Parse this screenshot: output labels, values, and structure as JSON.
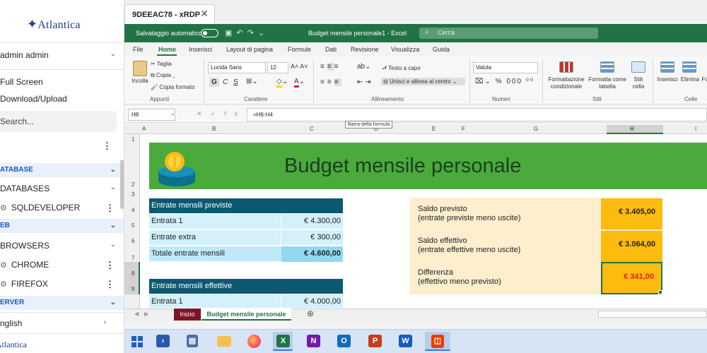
{
  "sidebar": {
    "logo": "Atlantica",
    "user": "admin admin",
    "full_screen": "Full Screen",
    "download_upload": "Download/Upload",
    "search_placeholder": "Search...",
    "sections": [
      {
        "label": "ATABASE"
      },
      {
        "label": "EB"
      },
      {
        "label": "ERVER"
      }
    ],
    "items": [
      {
        "label": "DATABASES"
      },
      {
        "label": "SQLDEVELOPER"
      },
      {
        "label": "BROWSERS"
      },
      {
        "label": "CHROME"
      },
      {
        "label": "FIREFOX"
      }
    ],
    "language": "nglish",
    "footer_logo": "Atlantica"
  },
  "remote_tab": {
    "title": "9DEEAC78 - xRDP"
  },
  "excel": {
    "autosave_label": "Salvataggio automatico",
    "doc_title": "Budget mensile personale1  -  Excel",
    "search_label": "Cerca",
    "ribbon_tabs": [
      "File",
      "Home",
      "Inserisci",
      "Layout di pagina",
      "Formule",
      "Dati",
      "Revisione",
      "Visualizza",
      "Guida"
    ],
    "clipboard": {
      "paste": "Incolla",
      "cut": "Taglia",
      "copy": "Copia",
      "format_painter": "Copia formato",
      "group": "Appunti"
    },
    "font": {
      "name": "Lucida Sans",
      "size": "12",
      "bold": "G",
      "italic": "C",
      "underline": "S",
      "group": "Carattere"
    },
    "alignment": {
      "wrap": "Testo a capo",
      "merge": "Unisci e allinea al centro",
      "group": "Allineamento"
    },
    "number": {
      "format": "Valuta",
      "group": "Numeri"
    },
    "styles": {
      "conditional": "Formattazione condizionale",
      "format_table": "Formatta come tabella",
      "cell_styles": "Stili cella",
      "group": "Stili"
    },
    "cells": {
      "insert": "Inserisci",
      "delete": "Elimina",
      "format": "Fo",
      "group": "Celle"
    },
    "name_box": "H8",
    "formula": "=H6-H4",
    "tooltip": "Barra della formula",
    "columns": [
      "A",
      "B",
      "C",
      "D",
      "E",
      "F",
      "G",
      "H",
      "I"
    ],
    "rows": [
      "1",
      "2",
      "3",
      "4",
      "5",
      "6",
      "7",
      "8",
      "9"
    ],
    "banner_title": "Budget mensile personale",
    "income_planned": {
      "header": "Entrate mensili previste",
      "rows": [
        {
          "label": "Entrata 1",
          "value": "€ 4.300,00"
        },
        {
          "label": "Entrate extra",
          "value": "€ 300,00"
        },
        {
          "label": "Totale entrate mensili",
          "value": "€ 4.600,00"
        }
      ]
    },
    "income_actual": {
      "header": "Entrate mensili effettive",
      "rows": [
        {
          "label": "Entrata 1",
          "value": "€ 4.000,00"
        }
      ]
    },
    "summary": [
      {
        "title": "Saldo previsto",
        "subtitle": "(entrate previste meno uscite)",
        "value": "€ 3.405,00"
      },
      {
        "title": "Saldo effettivo",
        "subtitle": "(entrate effettive meno uscite)",
        "value": "€ 3.064,00"
      },
      {
        "title": "Differenza",
        "subtitle": "(effettivo meno previsto)",
        "value": "€ 341,00"
      }
    ],
    "sheet_tabs": [
      "Inizio",
      "Budget mensile personale"
    ],
    "colors": {
      "excel_green": "#217346",
      "banner_green": "#4aaa3c",
      "table_header": "#0d5870",
      "table_row": "#d3f0fb",
      "summary_bg": "#fdeece",
      "summary_value": "#fdbb0f",
      "difference_text": "#e02020"
    }
  },
  "taskbar": {
    "icons": [
      "windows-start-icon",
      "powershell-icon",
      "server-manager-icon",
      "file-explorer-icon",
      "firefox-icon",
      "excel-icon",
      "onenote-icon",
      "outlook-icon",
      "powerpoint-icon",
      "word-icon",
      "office-icon"
    ]
  }
}
